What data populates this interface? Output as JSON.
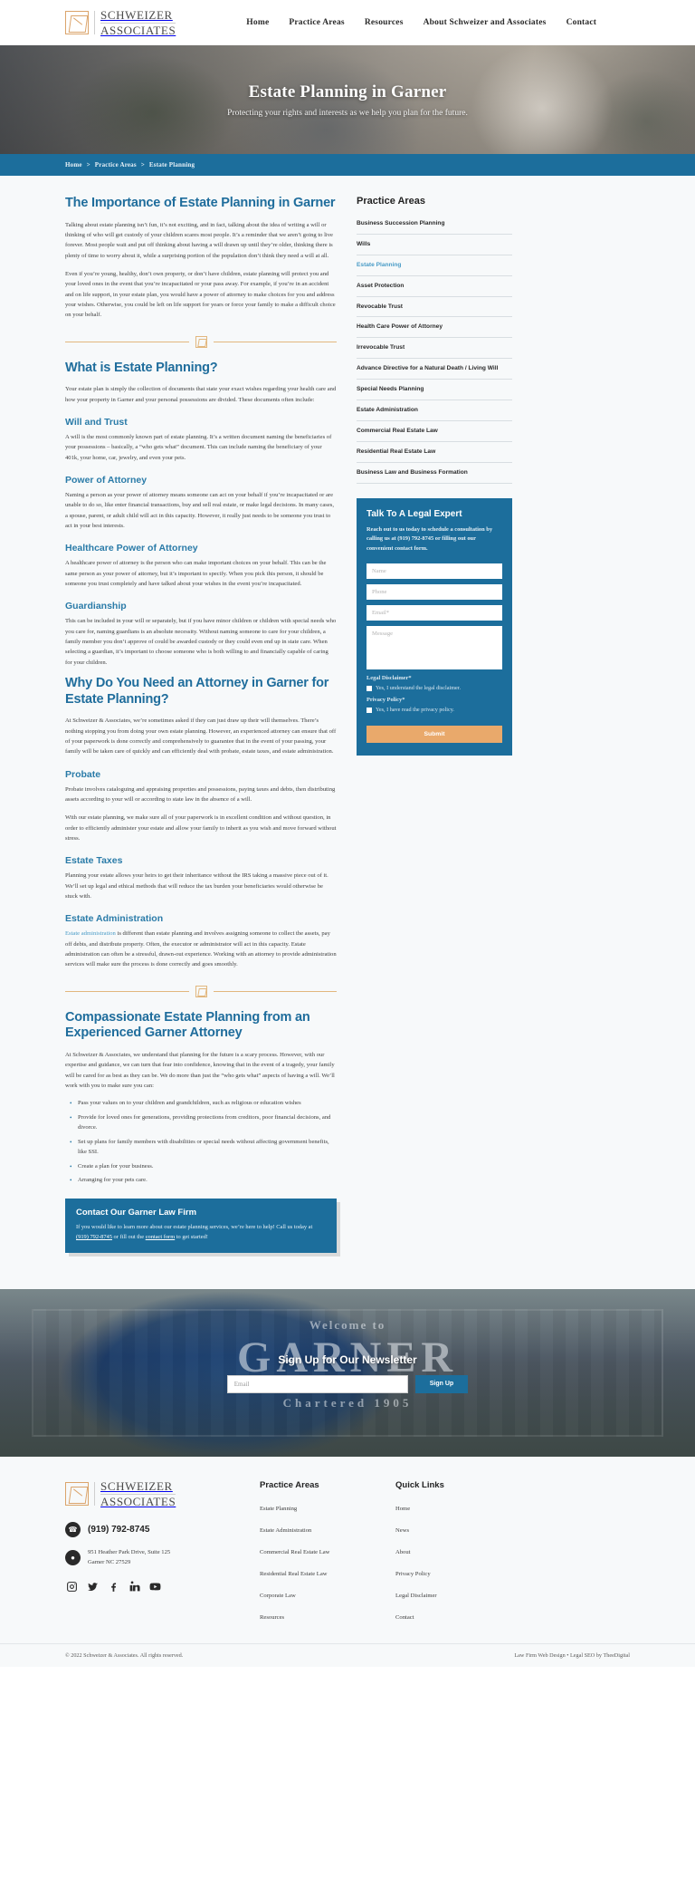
{
  "brand": {
    "line1": "SCHWEIZER",
    "line2": "ASSOCIATES",
    "amp": "&"
  },
  "nav": {
    "items": [
      {
        "label": "Home"
      },
      {
        "label": "Practice Areas"
      },
      {
        "label": "Resources"
      },
      {
        "label": "About Schweizer and Associates"
      },
      {
        "label": "Contact"
      }
    ]
  },
  "hero": {
    "title": "Estate Planning in Garner",
    "subtitle": "Protecting your rights and interests as we help you plan for the future."
  },
  "breadcrumb": {
    "home": "Home",
    "sep1": ">",
    "practice_areas": "Practice Areas",
    "sep2": ">",
    "current": "Estate Planning"
  },
  "content": {
    "h1": "The Importance of Estate Planning in Garner",
    "p1": "Talking about estate planning isn’t fun, it’s not exciting, and in fact, talking about the idea of writing a will or thinking of who will get custody of your children scares most people. It’s a reminder that we aren’t going to live forever. Most people wait and put off thinking about having a will drawn up until they’re older, thinking there is plenty of time to worry about it, while a surprising portion of the population don’t think they need a will at all.",
    "p2": "Even if you’re young, healthy, don’t own property, or don’t have children, estate planning will protect you and your loved ones in the event that you’re incapacitated or your pass away. For example, if you’re in an accident and on life support, in your estate plan, you would have a power of attorney to make choices for you and address your wishes. Otherwise, you could be left on life support for years or force your family to make a difficult choice on your behalf.",
    "h2_what": "What is Estate Planning?",
    "p_what": "Your estate plan is simply the collection of documents that state your exact wishes regarding your health care and how your property in Garner and your personal possessions are divided. These documents often include:",
    "h3_will": "Will and Trust",
    "p_will": "A will is the most commonly known part of estate planning. It’s a written document naming the beneficiaries of your possessions – basically, a “who gets what” document. This can include naming the beneficiary of your 401k, your home, car, jewelry, and even your pets.",
    "h3_poa": "Power of Attorney",
    "p_poa": "Naming a person as your power of attorney means someone can act on your behalf if you’re incapacitated or are unable to do so, like enter financial transactions, buy and sell real estate, or make legal decisions. In many cases, a spouse, parent, or adult child will act in this capacity. However, it really just needs to be someone you trust to act in your best interests.",
    "h3_hpoa": "Healthcare Power of Attorney",
    "p_hpoa": "A healthcare power of attorney is the person who can make important choices on your behalf. This can be the same person as your power of attorney, but it’s important to specify. When you pick this person, it should be someone you trust completely and have talked about your wishes in the event you’re incapacitated.",
    "h3_guard": "Guardianship",
    "p_guard": "This can be included in your will or separately, but if you have minor children or children with special needs who you care for, naming guardians is an absolute necessity. Without naming someone to care for your children, a family member you don’t approve of could be awarded custody or they could even end up in state care. When selecting a guardian, it’s important to choose someone who is both willing to and financially capable of caring for your children.",
    "h2_why": "Why Do You Need an Attorney in Garner for Estate Planning?",
    "p_why": "At Schweizer & Associates, we’re sometimes asked if they can just draw up their will themselves. There’s nothing stopping you from doing your own estate planning. However, an experienced attorney can ensure that off of your paperwork is done correctly and comprehensively to guarantee that in the event of your passing, your family will be taken care of quickly and can efficiently deal with probate, estate taxes, and estate administration.",
    "h3_probate": "Probate",
    "p_probate1": "Probate involves cataloguing and appraising properties and possessions, paying taxes and debts, then distributing assets according to your will or according to state law in the absence of a will.",
    "p_probate2": "With our estate planning, we make sure all of your paperwork is in excellent condition and without question, in order to efficiently administer your estate and allow your family to inherit as you wish and move forward without stress.",
    "h3_taxes": "Estate Taxes",
    "p_taxes": "Planning your estate allows your heirs to get their inheritance without the IRS taking a massive piece out of it. We’ll set up legal and ethical methods that will reduce the tax burden your beneficiaries would otherwise be stuck with.",
    "h3_admin": "Estate Administration",
    "p_admin_link": "Estate administration",
    "p_admin_rest": " is different than estate planning and involves assigning someone to collect the assets, pay off debts, and distribute property. Often, the executor or administrator will act in this capacity. Estate administration can often be a stressful, drawn-out experience. Working with an attorney to provide administration services will make sure the process is done correctly and goes smoothly.",
    "h2_compassionate": "Compassionate Estate Planning from an Experienced Garner Attorney",
    "p_compassionate": "At Schweizer & Associates, we understand that planning for the future is a scary process. However, with our expertise and guidance, we can turn that fear into confidence, knowing that in the event of a tragedy, your family will be cared for as best as they can be. We do more than just the “who gets what” aspects of having a will. We’ll work with you to make sure you can:",
    "bullets": [
      "Pass your values on to your children and grandchildren, such as religious or education wishes",
      "Provide for loved ones for generations, providing protections from creditors, poor financial decisions, and divorce.",
      "Set up plans for family members with disabilities or special needs without affecting government benefits, like SSI.",
      "Create a plan for your business.",
      "Arranging for your pets care."
    ],
    "cta": {
      "title": "Contact Our Garner Law Firm",
      "text_before": "If you would like to learn more about our estate planning services, we’re here to help! Call us today at ",
      "phone": "(919) 792-8745",
      "text_middle": " or fill out the ",
      "link": "contact form",
      "text_after": " to get started!"
    }
  },
  "sidebar": {
    "title": "Practice Areas",
    "items": [
      {
        "label": "Business Succession Planning",
        "active": false
      },
      {
        "label": "Wills",
        "active": false
      },
      {
        "label": "Estate Planning",
        "active": true
      },
      {
        "label": "Asset Protection",
        "active": false
      },
      {
        "label": "Revocable Trust",
        "active": false
      },
      {
        "label": "Health Care Power of Attorney",
        "active": false
      },
      {
        "label": "Irrevocable Trust",
        "active": false
      },
      {
        "label": "Advance Directive for a Natural Death / Living Will",
        "active": false
      },
      {
        "label": "Special Needs Planning",
        "active": false
      },
      {
        "label": "Estate Administration",
        "active": false
      },
      {
        "label": "Commercial Real Estate Law",
        "active": false
      },
      {
        "label": "Residential Real Estate Law",
        "active": false
      },
      {
        "label": "Business Law and Business Formation",
        "active": false
      }
    ],
    "form": {
      "title": "Talk To A Legal Expert",
      "intro": "Reach out to us today to schedule a consultation by calling us at (919) 792-8745 or filling out our convenient contact form.",
      "name_placeholder": "Name",
      "phone_placeholder": "Phone",
      "email_placeholder": "Email*",
      "message_placeholder": "Message",
      "legal_label": "Legal Disclaimer*",
      "legal_check": "Yes, I understand the legal disclaimer.",
      "privacy_label": "Privacy Policy*",
      "privacy_check": "Yes, I have read the privacy policy.",
      "submit": "Submit"
    }
  },
  "newsletter": {
    "ghost_line1": "Welcome to",
    "ghost_line2": "GARNER",
    "ghost_line3": "Chartered 1905",
    "title": "Sign Up for Our Newsletter",
    "email_placeholder": "Email",
    "button": "Sign Up"
  },
  "footer": {
    "phone": "(919) 792-8745",
    "address_line1": "951 Heather Park Drive, Suite 125",
    "address_line2": "Garner NC 27529",
    "social": [
      {
        "name": "instagram"
      },
      {
        "name": "twitter"
      },
      {
        "name": "facebook"
      },
      {
        "name": "linkedin"
      },
      {
        "name": "youtube"
      }
    ],
    "practice_areas": {
      "title": "Practice Areas",
      "items": [
        {
          "label": "Estate Planning"
        },
        {
          "label": "Estate Administration"
        },
        {
          "label": "Commercial Real Estate Law"
        },
        {
          "label": "Residential Real Estate Law"
        },
        {
          "label": "Corporate Law"
        },
        {
          "label": "Resources"
        }
      ]
    },
    "quick_links": {
      "title": "Quick Links",
      "items": [
        {
          "label": "Home"
        },
        {
          "label": "News"
        },
        {
          "label": "About"
        },
        {
          "label": "Privacy Policy"
        },
        {
          "label": "Legal Disclaimer"
        },
        {
          "label": "Contact"
        }
      ]
    },
    "copyright": "© 2022 Schweizer & Associates. All rights reserved.",
    "credit_1": "Law Firm Web Design",
    "credit_sep": "•",
    "credit_2": "Legal SEO by TheeDigital"
  },
  "colors": {
    "brand_blue": "#1c6e9c",
    "link_blue": "#4a9cc7",
    "accent_tan": "#e2b77e",
    "button_orange": "#e9a96b"
  }
}
